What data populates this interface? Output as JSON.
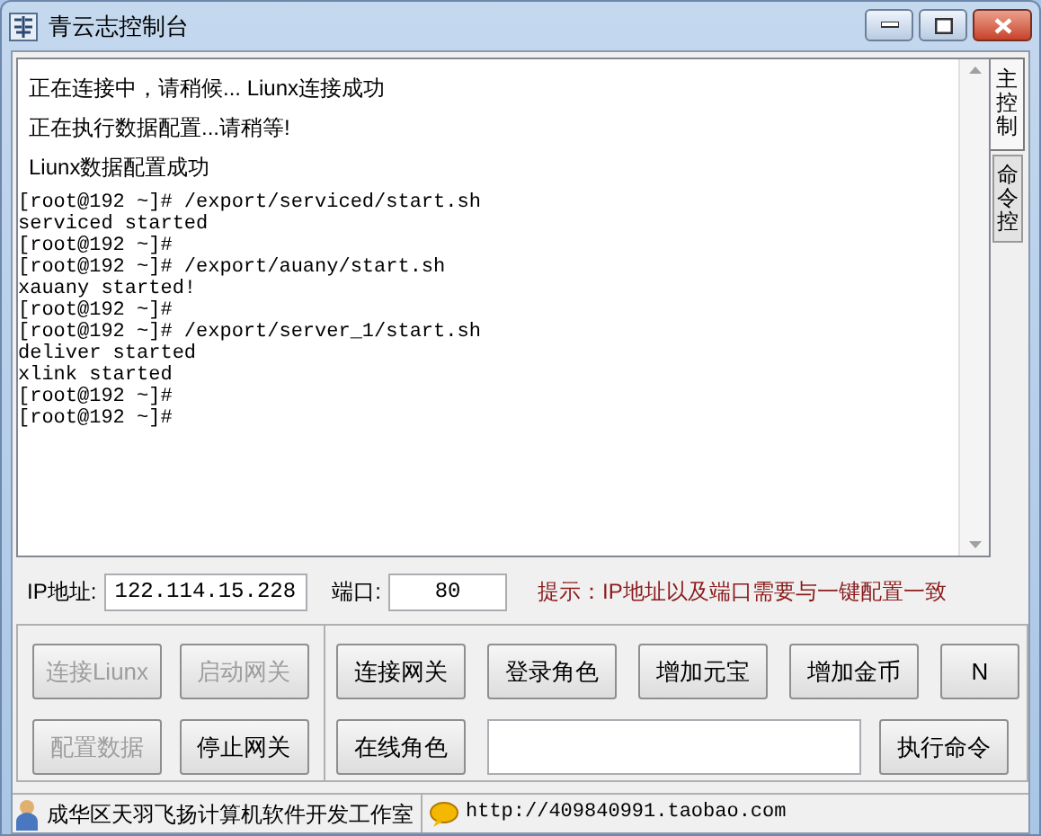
{
  "window": {
    "title": "青云志控制台"
  },
  "console": {
    "messages": [
      "正在连接中，请稍候... Liunx连接成功",
      "正在执行数据配置...请稍等!",
      "Liunx数据配置成功"
    ],
    "lines": [
      "[root@192 ~]# /export/serviced/start.sh",
      "serviced started",
      "[root@192 ~]#",
      "[root@192 ~]# /export/auany/start.sh",
      "xauany started!",
      "[root@192 ~]#",
      "[root@192 ~]# /export/server_1/start.sh",
      "deliver started",
      "xlink started",
      "[root@192 ~]#",
      "[root@192 ~]#"
    ]
  },
  "side_tabs": [
    {
      "label": "主控制",
      "selected": true
    },
    {
      "label": "命令控",
      "selected": false
    }
  ],
  "connection": {
    "ip_label": "IP地址:",
    "ip_value": "122.114.15.228",
    "port_label": "端口:",
    "port_value": "80",
    "hint": "提示：IP地址以及端口需要与一键配置一致"
  },
  "left_buttons": [
    {
      "label": "连接Liunx",
      "disabled": true
    },
    {
      "label": "启动网关",
      "disabled": true
    },
    {
      "label": "配置数据",
      "disabled": true
    },
    {
      "label": "停止网关",
      "disabled": false
    }
  ],
  "right_rows": [
    [
      {
        "kind": "button",
        "label": "连接网关"
      },
      {
        "kind": "button",
        "label": "登录角色"
      },
      {
        "kind": "button",
        "label": "增加元宝"
      },
      {
        "kind": "button",
        "label": "增加金币"
      },
      {
        "kind": "button",
        "label": "N"
      }
    ],
    [
      {
        "kind": "button",
        "label": "在线角色"
      },
      {
        "kind": "input"
      },
      {
        "kind": "button",
        "label": "执行命令"
      }
    ]
  ],
  "status_bar": {
    "studio": "成华区天羽飞扬计算机软件开发工作室",
    "url": "http://409840991.taobao.com"
  }
}
